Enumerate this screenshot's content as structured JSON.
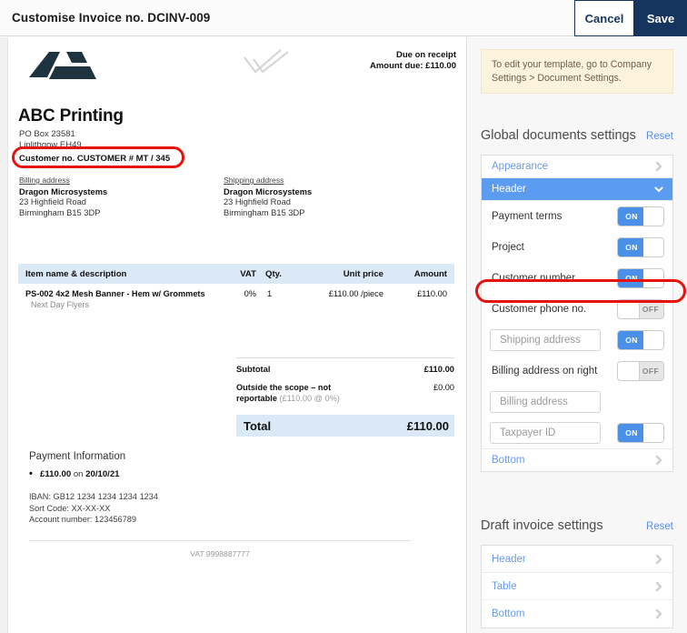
{
  "topbar": {
    "title": "Customise Invoice no. DCINV-009",
    "cancel_label": "Cancel",
    "save_label": "Save"
  },
  "document": {
    "due_terms": "Due on receipt",
    "amount_due": "Amount due: £110.00",
    "company_name": "ABC Printing",
    "company_address_line1": "PO Box 23581",
    "company_address_line2": "Linlithgow EH49",
    "customer_number": "Customer no. CUSTOMER # MT / 345",
    "billing": {
      "label": "Billing address",
      "name": "Dragon Microsystems",
      "line1": "23 Highfield Road",
      "line2": "Birmingham B15 3DP"
    },
    "shipping": {
      "label": "Shipping address",
      "name": "Dragon Microsystems",
      "line1": "23 Highfield Road",
      "line2": "Birmingham B15 3DP"
    },
    "table": {
      "headers": {
        "item": "Item name & description",
        "vat": "VAT",
        "qty": "Qty.",
        "unit_price": "Unit price",
        "amount": "Amount"
      },
      "rows": [
        {
          "item": "PS-002 4x2 Mesh Banner - Hem w/ Grommets",
          "description": "Next Day Flyers",
          "vat": "0%",
          "qty": "1",
          "unit_price": "£110.00 /piece",
          "amount": "£110.00"
        }
      ]
    },
    "totals": {
      "subtotal_label": "Subtotal",
      "subtotal_value": "£110.00",
      "scope_label": "Outside the scope – not reportable",
      "scope_detail": "(£110.00 @ 0%)",
      "scope_value": "£0.00",
      "total_label": "Total",
      "total_value": "£110.00"
    },
    "payment": {
      "title": "Payment Information",
      "line_amount": "£110.00",
      "line_on": " on ",
      "line_date": "20/10/21",
      "iban": "IBAN: GB12 1234 1234 1234 1234",
      "sort_code": "Sort Code: XX-XX-XX",
      "account": "Account number: 123456789"
    },
    "footer_vat": "VAT 9998887777"
  },
  "settings": {
    "note": "To edit your template, go to Company Settings > Document Settings.",
    "global": {
      "title": "Global documents settings",
      "reset_label": "Reset",
      "links": [
        {
          "label": "Appearance"
        },
        {
          "label": "Header"
        },
        {
          "label": "Bottom"
        }
      ],
      "toggles": [
        {
          "label": "Payment terms",
          "state": "ON"
        },
        {
          "label": "Project",
          "state": "ON"
        },
        {
          "label": "Customer number",
          "state": "ON"
        },
        {
          "label": "Customer phone no.",
          "state": "OFF"
        },
        {
          "label": "Shipping address",
          "state": "ON"
        },
        {
          "label": "Billing address on right",
          "state": "OFF"
        },
        {
          "label": "Billing address",
          "state": ""
        },
        {
          "label": "Taxpayer ID",
          "state": "ON"
        }
      ]
    },
    "draft": {
      "title": "Draft invoice settings",
      "reset_label": "Reset",
      "links": [
        {
          "label": "Header"
        },
        {
          "label": "Table"
        },
        {
          "label": "Bottom"
        }
      ]
    }
  },
  "colors": {
    "navy": "#16355e",
    "accent_blue": "#5b9bf0",
    "toggle_on": "#4a90e8",
    "table_head": "#dbe8f6",
    "highlight_red": "#e8120c",
    "note_bg": "#fcf3dd"
  }
}
